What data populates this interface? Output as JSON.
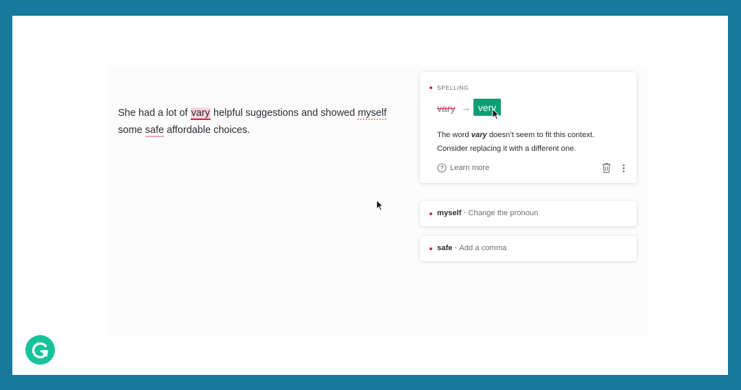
{
  "sentence": {
    "part1": "She had a lot of ",
    "word_vary": "vary",
    "part2": " helpful suggestions and showed ",
    "word_myself": "myself",
    "part3": "some ",
    "word_safe": "safe",
    "part4": " affordable choices."
  },
  "main_card": {
    "category": "SPELLING",
    "original": "vary",
    "arrow": "→",
    "replacement": "very",
    "explanation_pre": "The word ",
    "explanation_word": "vary",
    "explanation_post": " doesn’t seem to fit this context. Consider replacing it with a different one.",
    "learn_more": "Learn more"
  },
  "other_cards": [
    {
      "word": "myself",
      "sep": "·",
      "desc": "Change the pronoun"
    },
    {
      "word": "safe",
      "sep": "·",
      "desc": "Add a comma"
    }
  ],
  "colors": {
    "frame": "#167a9c",
    "accent_green": "#0f9d74",
    "error_red": "#d1223f",
    "logo_green": "#15c39a"
  },
  "icons": [
    "question-circle-icon",
    "trash-icon",
    "more-vertical-icon",
    "mouse-cursor-icon",
    "grammarly-logo-icon"
  ]
}
